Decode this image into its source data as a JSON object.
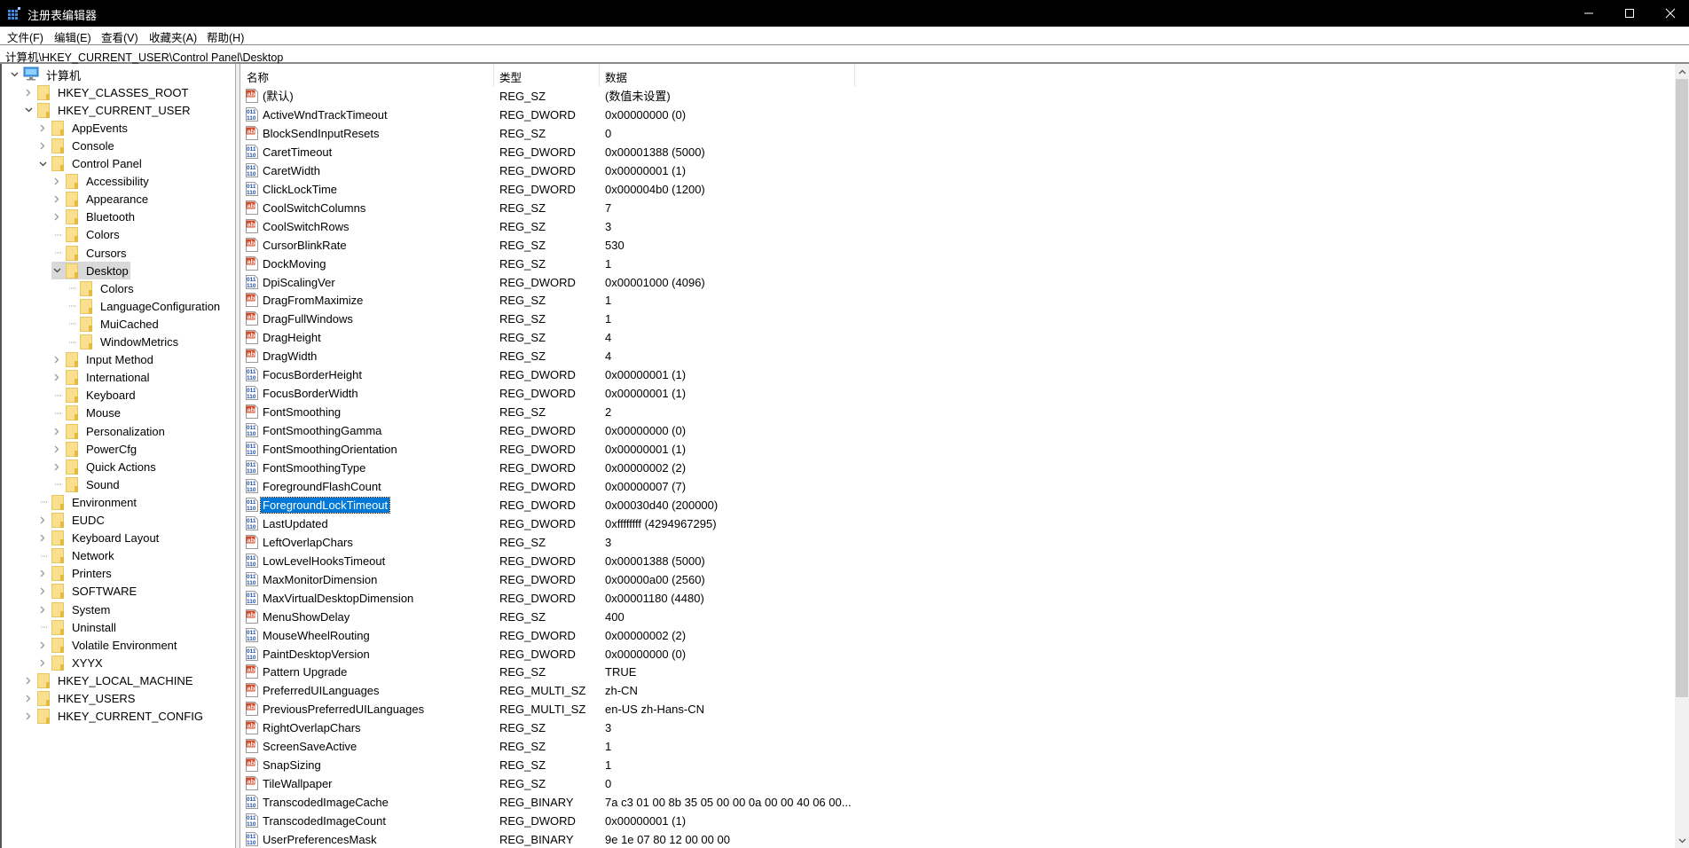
{
  "window": {
    "title": "注册表编辑器",
    "controls": {
      "minimize": "minimize",
      "maximize": "maximize",
      "close": "close"
    }
  },
  "menu": [
    {
      "label": "文件(F)"
    },
    {
      "label": "编辑(E)"
    },
    {
      "label": "查看(V)"
    },
    {
      "label": "收藏夹(A)"
    },
    {
      "label": "帮助(H)"
    }
  ],
  "address": "计算机\\HKEY_CURRENT_USER\\Control Panel\\Desktop",
  "tree": [
    {
      "label": "计算机",
      "level": 0,
      "expander": "expanded",
      "icon": "computer-icon"
    },
    {
      "label": "HKEY_CLASSES_ROOT",
      "level": 1,
      "expander": "collapsed"
    },
    {
      "label": "HKEY_CURRENT_USER",
      "level": 1,
      "expander": "expanded"
    },
    {
      "label": "AppEvents",
      "level": 2,
      "expander": "collapsed"
    },
    {
      "label": "Console",
      "level": 2,
      "expander": "collapsed"
    },
    {
      "label": "Control Panel",
      "level": 2,
      "expander": "expanded"
    },
    {
      "label": "Accessibility",
      "level": 3,
      "expander": "collapsed"
    },
    {
      "label": "Appearance",
      "level": 3,
      "expander": "collapsed"
    },
    {
      "label": "Bluetooth",
      "level": 3,
      "expander": "collapsed"
    },
    {
      "label": "Colors",
      "level": 3,
      "expander": "none"
    },
    {
      "label": "Cursors",
      "level": 3,
      "expander": "none"
    },
    {
      "label": "Desktop",
      "level": 3,
      "expander": "expanded",
      "selected": true
    },
    {
      "label": "Colors",
      "level": 4,
      "expander": "none"
    },
    {
      "label": "LanguageConfiguration",
      "level": 4,
      "expander": "none"
    },
    {
      "label": "MuiCached",
      "level": 4,
      "expander": "none"
    },
    {
      "label": "WindowMetrics",
      "level": 4,
      "expander": "none"
    },
    {
      "label": "Input Method",
      "level": 3,
      "expander": "collapsed"
    },
    {
      "label": "International",
      "level": 3,
      "expander": "collapsed"
    },
    {
      "label": "Keyboard",
      "level": 3,
      "expander": "none"
    },
    {
      "label": "Mouse",
      "level": 3,
      "expander": "none"
    },
    {
      "label": "Personalization",
      "level": 3,
      "expander": "collapsed"
    },
    {
      "label": "PowerCfg",
      "level": 3,
      "expander": "collapsed"
    },
    {
      "label": "Quick Actions",
      "level": 3,
      "expander": "collapsed"
    },
    {
      "label": "Sound",
      "level": 3,
      "expander": "none"
    },
    {
      "label": "Environment",
      "level": 2,
      "expander": "none"
    },
    {
      "label": "EUDC",
      "level": 2,
      "expander": "collapsed"
    },
    {
      "label": "Keyboard Layout",
      "level": 2,
      "expander": "collapsed"
    },
    {
      "label": "Network",
      "level": 2,
      "expander": "none"
    },
    {
      "label": "Printers",
      "level": 2,
      "expander": "collapsed"
    },
    {
      "label": "SOFTWARE",
      "level": 2,
      "expander": "collapsed"
    },
    {
      "label": "System",
      "level": 2,
      "expander": "collapsed"
    },
    {
      "label": "Uninstall",
      "level": 2,
      "expander": "none"
    },
    {
      "label": "Volatile Environment",
      "level": 2,
      "expander": "collapsed"
    },
    {
      "label": "XYYX",
      "level": 2,
      "expander": "collapsed"
    },
    {
      "label": "HKEY_LOCAL_MACHINE",
      "level": 1,
      "expander": "collapsed"
    },
    {
      "label": "HKEY_USERS",
      "level": 1,
      "expander": "collapsed"
    },
    {
      "label": "HKEY_CURRENT_CONFIG",
      "level": 1,
      "expander": "collapsed"
    }
  ],
  "columns": {
    "name": "名称",
    "type": "类型",
    "data": "数据"
  },
  "values": [
    {
      "icon": "string",
      "name": "(默认)",
      "type": "REG_SZ",
      "data": "(数值未设置)"
    },
    {
      "icon": "binary",
      "name": "ActiveWndTrackTimeout",
      "type": "REG_DWORD",
      "data": "0x00000000 (0)"
    },
    {
      "icon": "string",
      "name": "BlockSendInputResets",
      "type": "REG_SZ",
      "data": "0"
    },
    {
      "icon": "binary",
      "name": "CaretTimeout",
      "type": "REG_DWORD",
      "data": "0x00001388 (5000)"
    },
    {
      "icon": "binary",
      "name": "CaretWidth",
      "type": "REG_DWORD",
      "data": "0x00000001 (1)"
    },
    {
      "icon": "binary",
      "name": "ClickLockTime",
      "type": "REG_DWORD",
      "data": "0x000004b0 (1200)"
    },
    {
      "icon": "string",
      "name": "CoolSwitchColumns",
      "type": "REG_SZ",
      "data": "7"
    },
    {
      "icon": "string",
      "name": "CoolSwitchRows",
      "type": "REG_SZ",
      "data": "3"
    },
    {
      "icon": "string",
      "name": "CursorBlinkRate",
      "type": "REG_SZ",
      "data": "530"
    },
    {
      "icon": "string",
      "name": "DockMoving",
      "type": "REG_SZ",
      "data": "1"
    },
    {
      "icon": "binary",
      "name": "DpiScalingVer",
      "type": "REG_DWORD",
      "data": "0x00001000 (4096)"
    },
    {
      "icon": "string",
      "name": "DragFromMaximize",
      "type": "REG_SZ",
      "data": "1"
    },
    {
      "icon": "string",
      "name": "DragFullWindows",
      "type": "REG_SZ",
      "data": "1"
    },
    {
      "icon": "string",
      "name": "DragHeight",
      "type": "REG_SZ",
      "data": "4"
    },
    {
      "icon": "string",
      "name": "DragWidth",
      "type": "REG_SZ",
      "data": "4"
    },
    {
      "icon": "binary",
      "name": "FocusBorderHeight",
      "type": "REG_DWORD",
      "data": "0x00000001 (1)"
    },
    {
      "icon": "binary",
      "name": "FocusBorderWidth",
      "type": "REG_DWORD",
      "data": "0x00000001 (1)"
    },
    {
      "icon": "string",
      "name": "FontSmoothing",
      "type": "REG_SZ",
      "data": "2"
    },
    {
      "icon": "binary",
      "name": "FontSmoothingGamma",
      "type": "REG_DWORD",
      "data": "0x00000000 (0)"
    },
    {
      "icon": "binary",
      "name": "FontSmoothingOrientation",
      "type": "REG_DWORD",
      "data": "0x00000001 (1)"
    },
    {
      "icon": "binary",
      "name": "FontSmoothingType",
      "type": "REG_DWORD",
      "data": "0x00000002 (2)"
    },
    {
      "icon": "binary",
      "name": "ForegroundFlashCount",
      "type": "REG_DWORD",
      "data": "0x00000007 (7)"
    },
    {
      "icon": "binary",
      "name": "ForegroundLockTimeout",
      "type": "REG_DWORD",
      "data": "0x00030d40 (200000)",
      "selected": true
    },
    {
      "icon": "binary",
      "name": "LastUpdated",
      "type": "REG_DWORD",
      "data": "0xffffffff (4294967295)"
    },
    {
      "icon": "string",
      "name": "LeftOverlapChars",
      "type": "REG_SZ",
      "data": "3"
    },
    {
      "icon": "binary",
      "name": "LowLevelHooksTimeout",
      "type": "REG_DWORD",
      "data": "0x00001388 (5000)"
    },
    {
      "icon": "binary",
      "name": "MaxMonitorDimension",
      "type": "REG_DWORD",
      "data": "0x00000a00 (2560)"
    },
    {
      "icon": "binary",
      "name": "MaxVirtualDesktopDimension",
      "type": "REG_DWORD",
      "data": "0x00001180 (4480)"
    },
    {
      "icon": "string",
      "name": "MenuShowDelay",
      "type": "REG_SZ",
      "data": "400"
    },
    {
      "icon": "binary",
      "name": "MouseWheelRouting",
      "type": "REG_DWORD",
      "data": "0x00000002 (2)"
    },
    {
      "icon": "binary",
      "name": "PaintDesktopVersion",
      "type": "REG_DWORD",
      "data": "0x00000000 (0)"
    },
    {
      "icon": "string",
      "name": "Pattern Upgrade",
      "type": "REG_SZ",
      "data": "TRUE"
    },
    {
      "icon": "string",
      "name": "PreferredUILanguages",
      "type": "REG_MULTI_SZ",
      "data": "zh-CN"
    },
    {
      "icon": "string",
      "name": "PreviousPreferredUILanguages",
      "type": "REG_MULTI_SZ",
      "data": "en-US zh-Hans-CN"
    },
    {
      "icon": "string",
      "name": "RightOverlapChars",
      "type": "REG_SZ",
      "data": "3"
    },
    {
      "icon": "string",
      "name": "ScreenSaveActive",
      "type": "REG_SZ",
      "data": "1"
    },
    {
      "icon": "string",
      "name": "SnapSizing",
      "type": "REG_SZ",
      "data": "1"
    },
    {
      "icon": "string",
      "name": "TileWallpaper",
      "type": "REG_SZ",
      "data": "0"
    },
    {
      "icon": "binary",
      "name": "TranscodedImageCache",
      "type": "REG_BINARY",
      "data": "7a c3 01 00 8b 35 05 00 00 0a 00 00 40 06 00..."
    },
    {
      "icon": "binary",
      "name": "TranscodedImageCount",
      "type": "REG_DWORD",
      "data": "0x00000001 (1)"
    },
    {
      "icon": "binary",
      "name": "UserPreferencesMask",
      "type": "REG_BINARY",
      "data": "9e 1e 07 80 12 00 00 00"
    }
  ],
  "scroll": {
    "thumb_fraction": 0.82,
    "position_fraction": 0.0
  },
  "colors": {
    "selection": "#0078d7",
    "titlebar": "#000000",
    "tree_selection": "#d9d9d9"
  }
}
